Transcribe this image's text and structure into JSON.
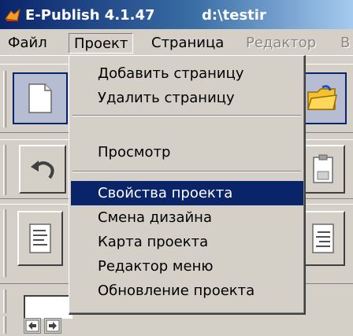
{
  "window": {
    "title": "E-Publish 4.1.47",
    "path": "d:\\testir",
    "icon": "app-icon"
  },
  "menubar": {
    "items": [
      {
        "label": "Файл",
        "state": "normal"
      },
      {
        "label": "Проект",
        "state": "open"
      },
      {
        "label": "Страница",
        "state": "normal"
      },
      {
        "label": "Редактор",
        "state": "disabled"
      },
      {
        "label": "В",
        "state": "disabled"
      }
    ]
  },
  "dropdown": {
    "items": [
      {
        "label": "Добавить страницу",
        "selected": false
      },
      {
        "label": "Удалить страницу",
        "selected": false
      },
      {
        "label": "Просмотр",
        "selected": false
      },
      {
        "label": "Свойства проекта",
        "selected": true
      },
      {
        "label": "Смена дизайна",
        "selected": false
      },
      {
        "label": "Карта проекта",
        "selected": false
      },
      {
        "label": "Редактор меню",
        "selected": false
      },
      {
        "label": "Обновление проекта",
        "selected": false
      }
    ]
  },
  "toolbar": {
    "icons": [
      "new-page-icon",
      "open-folder-icon",
      "undo-icon",
      "paste-icon",
      "align-left-icon",
      "align-right-icon",
      "back-arrow-icon",
      "forward-arrow-icon"
    ]
  },
  "colors": {
    "selection": "#0a246a",
    "face": "#d4d0c8",
    "disabled": "#8a877f"
  }
}
